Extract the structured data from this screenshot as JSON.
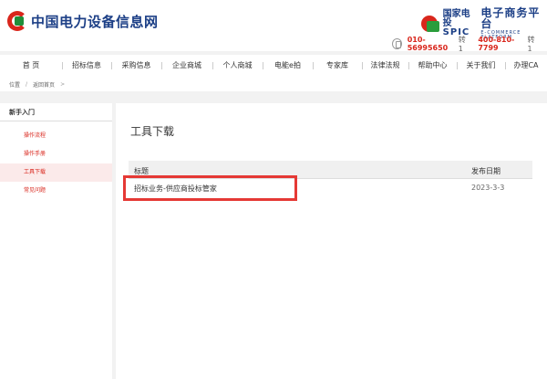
{
  "header": {
    "logo_text": "中国电力设备信息网",
    "spic_cn": "国家电投",
    "spic_en": "SPIC",
    "platform_cn": "电子商务平台",
    "platform_en": "E-COMMERCE PLATFORM",
    "phones": [
      {
        "number": "010-56995650",
        "ext": "转 1"
      },
      {
        "number": "400-810-7799",
        "ext": "转 1"
      }
    ]
  },
  "nav": {
    "items": [
      "首 页",
      "招标信息",
      "采购信息",
      "企业商城",
      "个人商城",
      "电能e拍",
      "专家库",
      "法律法规",
      "帮助中心",
      "关于我们",
      "办理CA"
    ]
  },
  "breadcrumb": {
    "home": "位置",
    "sep": "/",
    "current": "返回首页",
    "sep2": ">"
  },
  "sidebar": {
    "heading": "新手入门",
    "items": [
      {
        "label": "操作流程",
        "active": false
      },
      {
        "label": "操作手册",
        "active": false
      },
      {
        "label": "工具下载",
        "active": true
      },
      {
        "label": "常见问题",
        "active": false
      }
    ]
  },
  "main": {
    "title": "工具下载",
    "table": {
      "col_title": "标题",
      "col_date": "发布日期",
      "rows": [
        {
          "title": "招标业务-供应商投标管家",
          "date": "2023-3-3"
        }
      ]
    }
  },
  "colors": {
    "brand_red": "#d9261c",
    "brand_blue": "#1c3f86",
    "highlight": "#e53935"
  }
}
